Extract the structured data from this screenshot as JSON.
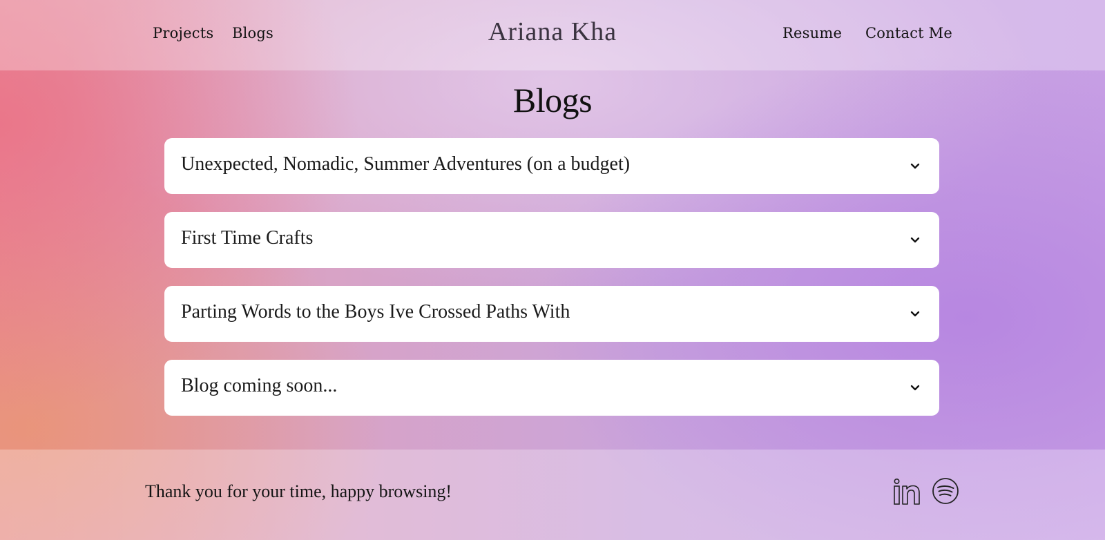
{
  "header": {
    "nav_left": [
      {
        "label": "Projects"
      },
      {
        "label": "Blogs"
      }
    ],
    "brand": "Ariana Kha",
    "nav_right": [
      {
        "label": "Resume"
      },
      {
        "label": "Contact Me"
      }
    ]
  },
  "main": {
    "title": "Blogs",
    "accordion": [
      {
        "title": "Unexpected, Nomadic, Summer Adventures (on a budget)",
        "icon": "chevron-down-icon"
      },
      {
        "title": "First Time Crafts",
        "icon": "chevron-down-icon"
      },
      {
        "title": "Parting Words to the Boys Ive Crossed Paths With",
        "icon": "chevron-down-icon"
      },
      {
        "title": "Blog coming soon...",
        "icon": "chevron-down-icon"
      }
    ]
  },
  "footer": {
    "message": "Thank you for your time, happy browsing!",
    "social": [
      {
        "icon": "linkedin-icon"
      },
      {
        "icon": "spotify-icon"
      }
    ]
  },
  "colors": {
    "card_background": "#ffffff",
    "text": "#141414",
    "brand_text": "#3a3340"
  }
}
